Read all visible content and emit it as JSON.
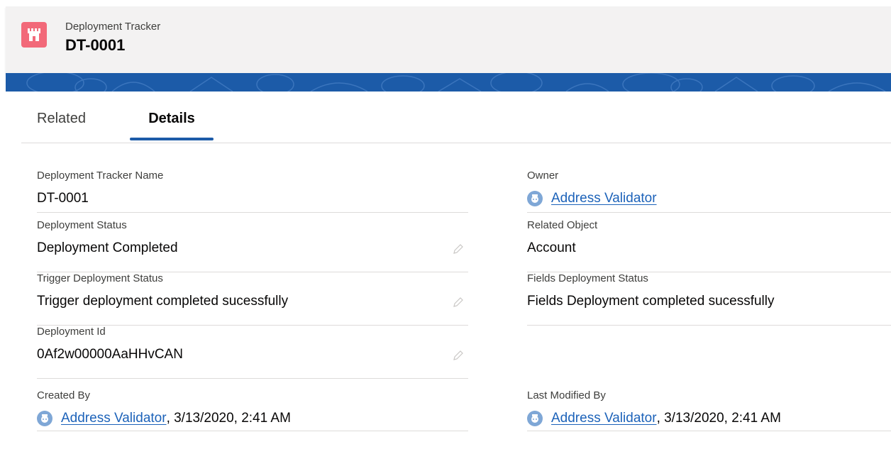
{
  "header": {
    "object_label": "Deployment Tracker",
    "record_title": "DT-0001",
    "icon": "castle-icon",
    "icon_color": "#f26979"
  },
  "tabs": [
    {
      "label": "Related",
      "active": false
    },
    {
      "label": "Details",
      "active": true
    }
  ],
  "fields": {
    "tracker_name": {
      "label": "Deployment Tracker Name",
      "value": "DT-0001"
    },
    "owner": {
      "label": "Owner",
      "value": "Address Validator"
    },
    "deployment_status": {
      "label": "Deployment Status",
      "value": "Deployment Completed"
    },
    "related_object": {
      "label": "Related Object",
      "value": "Account"
    },
    "trigger_status": {
      "label": "Trigger Deployment Status",
      "value": "Trigger deployment completed sucessfully"
    },
    "fields_status": {
      "label": "Fields Deployment Status",
      "value": "Fields Deployment completed sucessfully"
    },
    "deployment_id": {
      "label": "Deployment Id",
      "value": "0Af2w00000AaHHvCAN"
    },
    "created_by": {
      "label": "Created By",
      "user": "Address Validator",
      "date": ", 3/13/2020, 2:41 AM"
    },
    "last_modified_by": {
      "label": "Last Modified By",
      "user": "Address Validator",
      "date": ", 3/13/2020, 2:41 AM"
    }
  },
  "colors": {
    "link": "#1c62b9",
    "brand_band": "#1c5ba8"
  }
}
